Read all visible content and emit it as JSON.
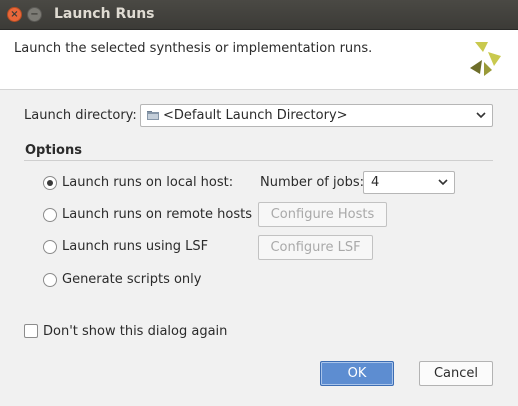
{
  "window": {
    "title": "Launch Runs"
  },
  "header": {
    "description": "Launch the selected synthesis or implementation runs."
  },
  "launch_directory": {
    "label": "Launch directory:",
    "value": "<Default Launch Directory>"
  },
  "options": {
    "title": "Options",
    "radios": [
      {
        "label": "Launch runs on local host:",
        "selected": true
      },
      {
        "label": "Launch runs on remote hosts",
        "selected": false
      },
      {
        "label": "Launch runs using LSF",
        "selected": false
      },
      {
        "label": "Generate scripts only",
        "selected": false
      }
    ],
    "jobs": {
      "label": "Number of jobs:",
      "value": "4"
    },
    "configure_hosts_label": "Configure Hosts",
    "configure_lsf_label": "Configure LSF"
  },
  "dont_show": {
    "label": "Don't show this dialog again",
    "checked": false
  },
  "buttons": {
    "ok": "OK",
    "cancel": "Cancel"
  },
  "colors": {
    "titlebar": "#3c3b37",
    "close_button": "#e9673a",
    "ok_button": "#5d8dd1",
    "logo_light": "#c9c94e",
    "logo_dark": "#6e6e2a"
  }
}
